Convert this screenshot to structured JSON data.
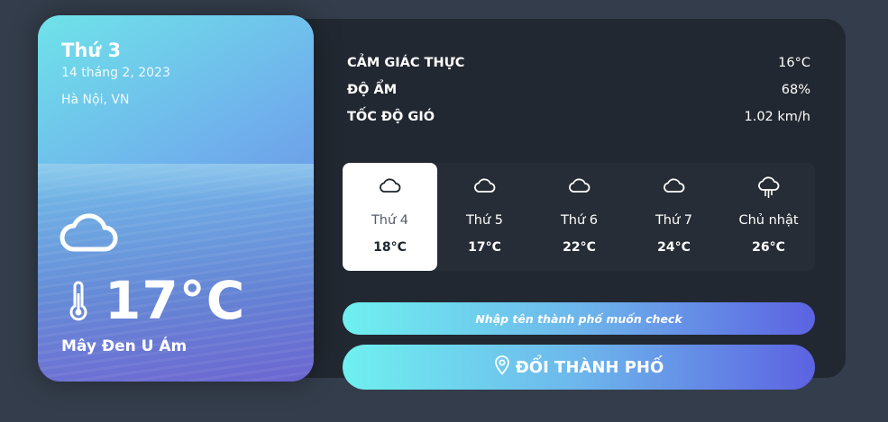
{
  "current": {
    "weekday": "Thứ 3",
    "date": "14 tháng 2, 2023",
    "location": "Hà Nội, VN",
    "icon": "cloud-icon",
    "temperature": "17°C",
    "description": "Mây Đen U Ám"
  },
  "stats": [
    {
      "label": "CẢM GIÁC THỰC",
      "value": "16°C"
    },
    {
      "label": "ĐỘ ẨM",
      "value": "68%"
    },
    {
      "label": "TỐC ĐỘ GIÓ",
      "value": "1.02 km/h"
    }
  ],
  "forecast": [
    {
      "day": "Thứ 4",
      "temp": "18°C",
      "icon": "cloud-icon",
      "active": true
    },
    {
      "day": "Thứ 5",
      "temp": "17°C",
      "icon": "cloud-icon",
      "active": false
    },
    {
      "day": "Thứ 6",
      "temp": "22°C",
      "icon": "cloud-icon",
      "active": false
    },
    {
      "day": "Thứ 7",
      "temp": "24°C",
      "icon": "cloud-icon",
      "active": false
    },
    {
      "day": "Chủ nhật",
      "temp": "26°C",
      "icon": "cloud-rain-icon",
      "active": false
    }
  ],
  "search": {
    "placeholder": "Nhập tên thành phố muốn check",
    "value": ""
  },
  "change_button": {
    "label": "ĐỔI THÀNH PHỐ",
    "icon": "map-pin-icon"
  },
  "colors": {
    "page_bg": "#343d4b",
    "panel_bg": "#222831",
    "gradient_start": "#6ff0ef",
    "gradient_end": "#5c63e1"
  }
}
